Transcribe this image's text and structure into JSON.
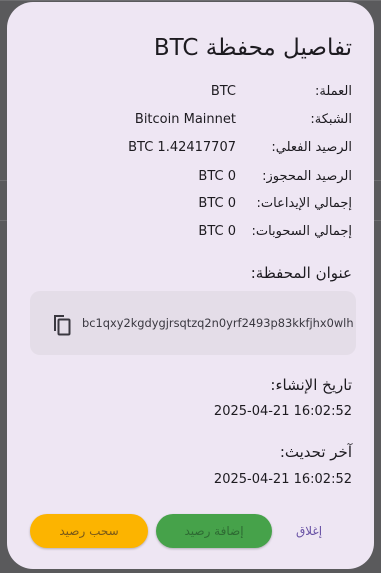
{
  "dialog": {
    "title": "تفاصيل محفظة BTC",
    "rows": [
      {
        "label": "العملة:",
        "value": "BTC"
      },
      {
        "label": "الشبكة:",
        "value": "Bitcoin Mainnet"
      },
      {
        "label": "الرصيد الفعلي:",
        "value": "BTC 1.42417707"
      },
      {
        "label": "الرصيد المحجوز:",
        "value": "BTC 0"
      },
      {
        "label": "إجمالي الإيداعات:",
        "value": "BTC 0"
      },
      {
        "label": "إجمالي السحوبات:",
        "value": "BTC 0"
      }
    ],
    "address_heading": "عنوان المحفظة:",
    "address": "bc1qxy2kgdygjrsqtzq2n0yrf2493p83kkfjhx0wlh",
    "created_heading": "تاريخ الإنشاء:",
    "created_value": "2025-04-21 16:02:52",
    "updated_heading": "آخر تحديث:",
    "updated_value": "2025-04-21 16:02:52",
    "buttons": {
      "withdraw": "سحب رصيد",
      "deposit": "إضافة رصيد",
      "close": "إغلاق"
    }
  },
  "colors": {
    "dialog_bg": "#eee6f3",
    "withdraw": "#fcb400",
    "deposit": "#46a24a",
    "close_text": "#6750a4"
  },
  "icons": {
    "copy": "copy-icon"
  }
}
